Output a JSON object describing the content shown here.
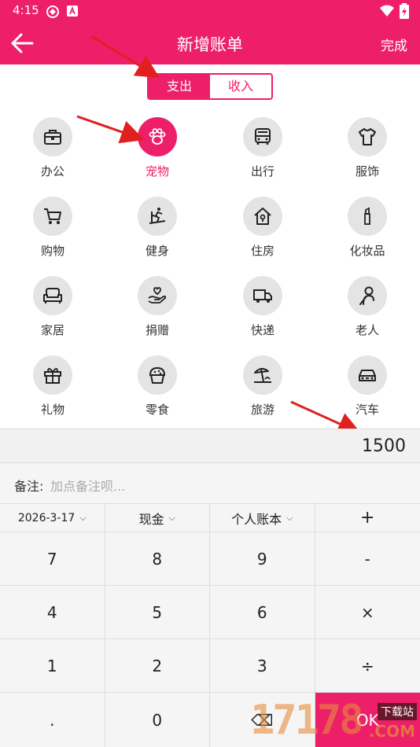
{
  "status": {
    "time": "4:15"
  },
  "appbar": {
    "title": "新增账单",
    "done": "完成"
  },
  "tabs": {
    "expense": "支出",
    "income": "收入",
    "active": "expense"
  },
  "categories": [
    {
      "label": "办公",
      "icon": "briefcase-icon"
    },
    {
      "label": "宠物",
      "icon": "paw-icon",
      "selected": true
    },
    {
      "label": "出行",
      "icon": "bus-icon"
    },
    {
      "label": "服饰",
      "icon": "tshirt-icon"
    },
    {
      "label": "购物",
      "icon": "cart-icon"
    },
    {
      "label": "健身",
      "icon": "treadmill-icon"
    },
    {
      "label": "住房",
      "icon": "house-icon"
    },
    {
      "label": "化妆品",
      "icon": "lipstick-icon"
    },
    {
      "label": "家居",
      "icon": "sofa-icon"
    },
    {
      "label": "捐赠",
      "icon": "donate-icon"
    },
    {
      "label": "快递",
      "icon": "truck-icon"
    },
    {
      "label": "老人",
      "icon": "elder-icon"
    },
    {
      "label": "礼物",
      "icon": "gift-icon"
    },
    {
      "label": "零食",
      "icon": "cupcake-icon"
    },
    {
      "label": "旅游",
      "icon": "beach-icon"
    },
    {
      "label": "汽车",
      "icon": "car-icon"
    }
  ],
  "amount": "1500",
  "note": {
    "label": "备注:",
    "placeholder": "加点备注呗..."
  },
  "options": {
    "date": "2026-3-17",
    "account_type": "现金",
    "book": "个人账本",
    "plus": "+"
  },
  "keypad": {
    "r1": [
      "7",
      "8",
      "9",
      "-"
    ],
    "r2": [
      "4",
      "5",
      "6",
      "×"
    ],
    "r3": [
      "1",
      "2",
      "3",
      "÷"
    ],
    "r4": [
      ".",
      "0",
      "⌫",
      "OK"
    ]
  },
  "watermark": {
    "number": "17178",
    "tag": "下载站",
    "domain": ".COM"
  },
  "colors": {
    "accent": "#ed1f69",
    "icon_bg": "#e4e4e4"
  }
}
